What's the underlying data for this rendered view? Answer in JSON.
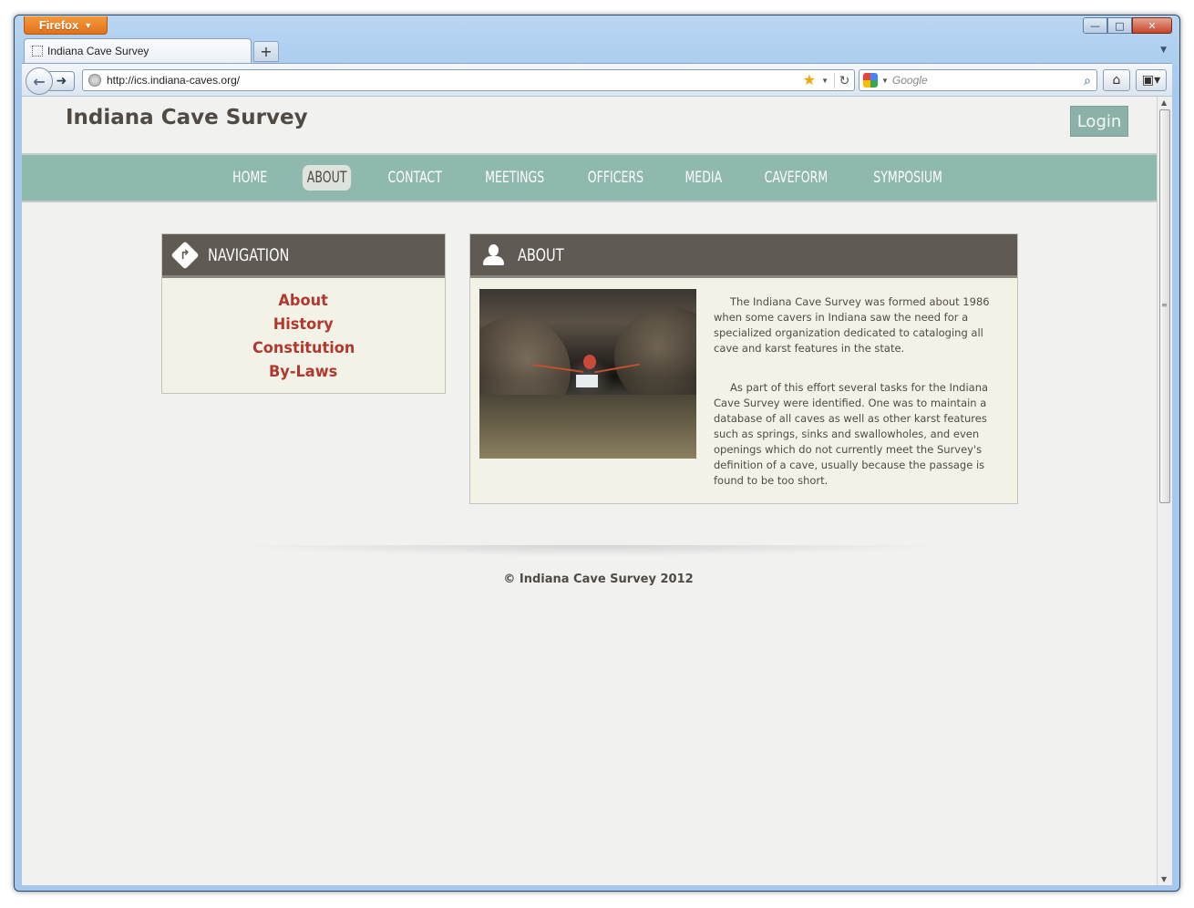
{
  "browser": {
    "app_button": "Firefox",
    "tab_title": "Indiana Cave Survey",
    "new_tab": "+",
    "url": "http://ics.indiana-caves.org/",
    "search_placeholder": "Google",
    "controls": {
      "minimize": "—",
      "maximize": "□",
      "close": "✕"
    }
  },
  "site": {
    "title": "Indiana Cave Survey",
    "login_label": "Login",
    "nav": [
      {
        "label": "HOME",
        "active": false
      },
      {
        "label": "ABOUT",
        "active": true
      },
      {
        "label": "CONTACT",
        "active": false
      },
      {
        "label": "MEETINGS",
        "active": false
      },
      {
        "label": "OFFICERS",
        "active": false
      },
      {
        "label": "MEDIA",
        "active": false
      },
      {
        "label": "CAVEFORM",
        "active": false
      },
      {
        "label": "SYMPOSIUM",
        "active": false
      }
    ],
    "navigation_panel": {
      "title": "NAVIGATION",
      "links": [
        "About",
        "History",
        "Constitution",
        "By-Laws"
      ]
    },
    "about_panel": {
      "title": "ABOUT",
      "paragraphs": [
        "The Indiana Cave Survey was formed about 1986 when some cavers in Indiana saw the need for a specialized organization dedicated to cataloging all cave and karst features in the state.",
        "As part of this effort several tasks for the Indiana Cave Survey were identified. One was to maintain a database of all caves as well as other karst features such as springs, sinks and swallowholes, and even openings which do not currently meet the Survey's definition of a cave, usually because the passage is found to be too short."
      ]
    },
    "footer": "© Indiana Cave Survey 2012"
  }
}
